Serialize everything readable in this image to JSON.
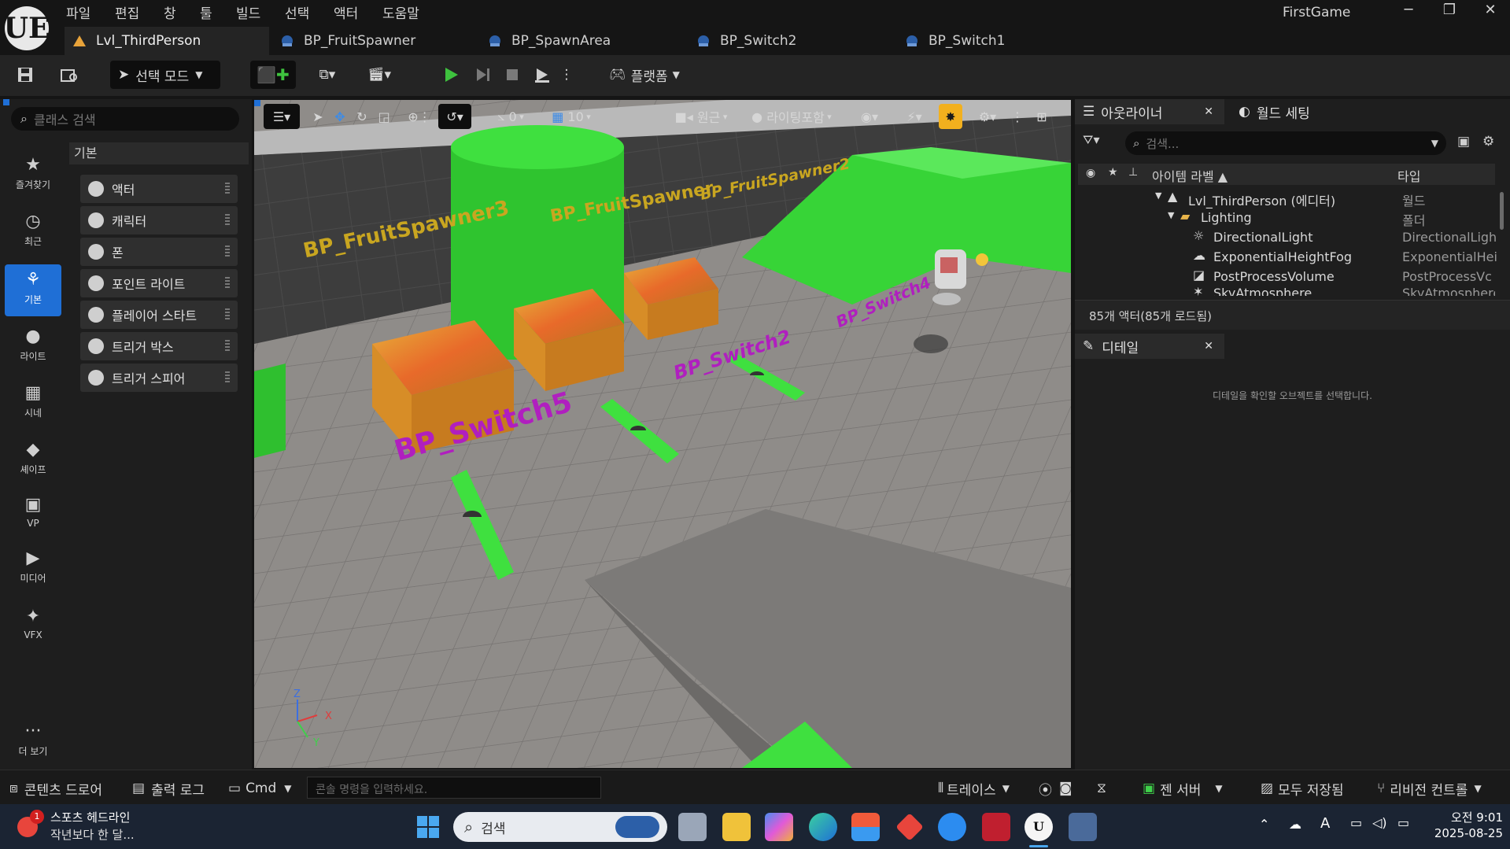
{
  "app": {
    "logo": "UE",
    "window_title": "FirstGame",
    "menu": [
      "파일",
      "편집",
      "창",
      "툴",
      "빌드",
      "선택",
      "액터",
      "도움말"
    ],
    "window_buttons": [
      "─",
      "❐",
      "✕"
    ]
  },
  "tabs": [
    {
      "label": "Lvl_ThirdPerson",
      "icon": "level-icon"
    },
    {
      "label": "BP_FruitSpawner",
      "icon": "blueprint-icon"
    },
    {
      "label": "BP_SpawnArea",
      "icon": "blueprint-icon"
    },
    {
      "label": "BP_Switch2",
      "icon": "blueprint-icon"
    },
    {
      "label": "BP_Switch1",
      "icon": "blueprint-icon"
    }
  ],
  "toolbar": {
    "select_mode": "선택 모드",
    "platform": "플랫폼"
  },
  "place_panel": {
    "search_placeholder": "클래스 검색",
    "categories": [
      {
        "label": "즐겨찾기",
        "icon": "star-icon",
        "glyph": "★"
      },
      {
        "label": "최근",
        "icon": "clock-icon",
        "glyph": "◷"
      },
      {
        "label": "기본",
        "icon": "shapes-icon",
        "glyph": "⚘"
      },
      {
        "label": "라이트",
        "icon": "bulb-icon",
        "glyph": "●"
      },
      {
        "label": "시네",
        "icon": "clapper-icon",
        "glyph": "▦"
      },
      {
        "label": "셰이프",
        "icon": "cube-icon",
        "glyph": "◆"
      },
      {
        "label": "VP",
        "icon": "vp-icon",
        "glyph": "▣"
      },
      {
        "label": "미디어",
        "icon": "media-icon",
        "glyph": "▶"
      },
      {
        "label": "VFX",
        "icon": "sparkle-icon",
        "glyph": "✦"
      }
    ],
    "more": "더 보기",
    "section": "기본",
    "items": [
      "액터",
      "캐릭터",
      "폰",
      "포인트 라이트",
      "플레이어 스타트",
      "트리거 박스",
      "트리거 스피어"
    ]
  },
  "viewport": {
    "snap_rotation": "0",
    "snap_grid": "10",
    "view_mode": "원근",
    "lighting": "라이팅포함",
    "labels": [
      "BP_FruitSpawner3",
      "BP_FruitSpawner",
      "BP_FruitSpawner2",
      "BP_Switch5",
      "BP_Switch2",
      "BP_Switch4"
    ],
    "axis": [
      "Z",
      "X",
      "Y"
    ]
  },
  "outliner": {
    "tab": "아웃라이너",
    "world_tab": "월드 세팅",
    "search_placeholder": "검색...",
    "col_label": "아이템 라벨 ▲",
    "col_type": "타입",
    "rows": [
      {
        "label": "Lvl_ThirdPerson (에디터)",
        "type": "월드"
      },
      {
        "label": "Lighting",
        "type": "폴더"
      },
      {
        "label": "DirectionalLight",
        "type": "DirectionalLigh"
      },
      {
        "label": "ExponentialHeightFog",
        "type": "ExponentialHei"
      },
      {
        "label": "PostProcessVolume",
        "type": "PostProcessVc"
      },
      {
        "label": "SkyAtmosphere",
        "type": "SkyAtmosphere"
      }
    ],
    "count": "85개 액터(85개 로드됨)"
  },
  "details": {
    "tab": "디테일",
    "empty": "디테일을 확인할 오브젝트를 선택합니다."
  },
  "statusbar": {
    "content_drawer": "콘텐츠 드로어",
    "output_log": "출력 로그",
    "cmd": "Cmd",
    "console_placeholder": "콘솔 명령을 입력하세요.",
    "trace": "트레이스",
    "zen": "젠 서버",
    "saved": "모두 저장됨",
    "revision": "리비전 컨트롤"
  },
  "taskbar": {
    "news_badge": "1",
    "news_title": "스포츠 헤드라인",
    "news_sub": "작년보다 한 달...",
    "search": "검색",
    "time": "오전 9:01",
    "date": "2025-08-25",
    "ime": "A"
  },
  "colors": {
    "accent": "#1f6fd6",
    "play": "#3ec23e",
    "label_purple": "#b01fbf",
    "label_gold": "#c9a620",
    "floor_green": "#3fe03f"
  }
}
